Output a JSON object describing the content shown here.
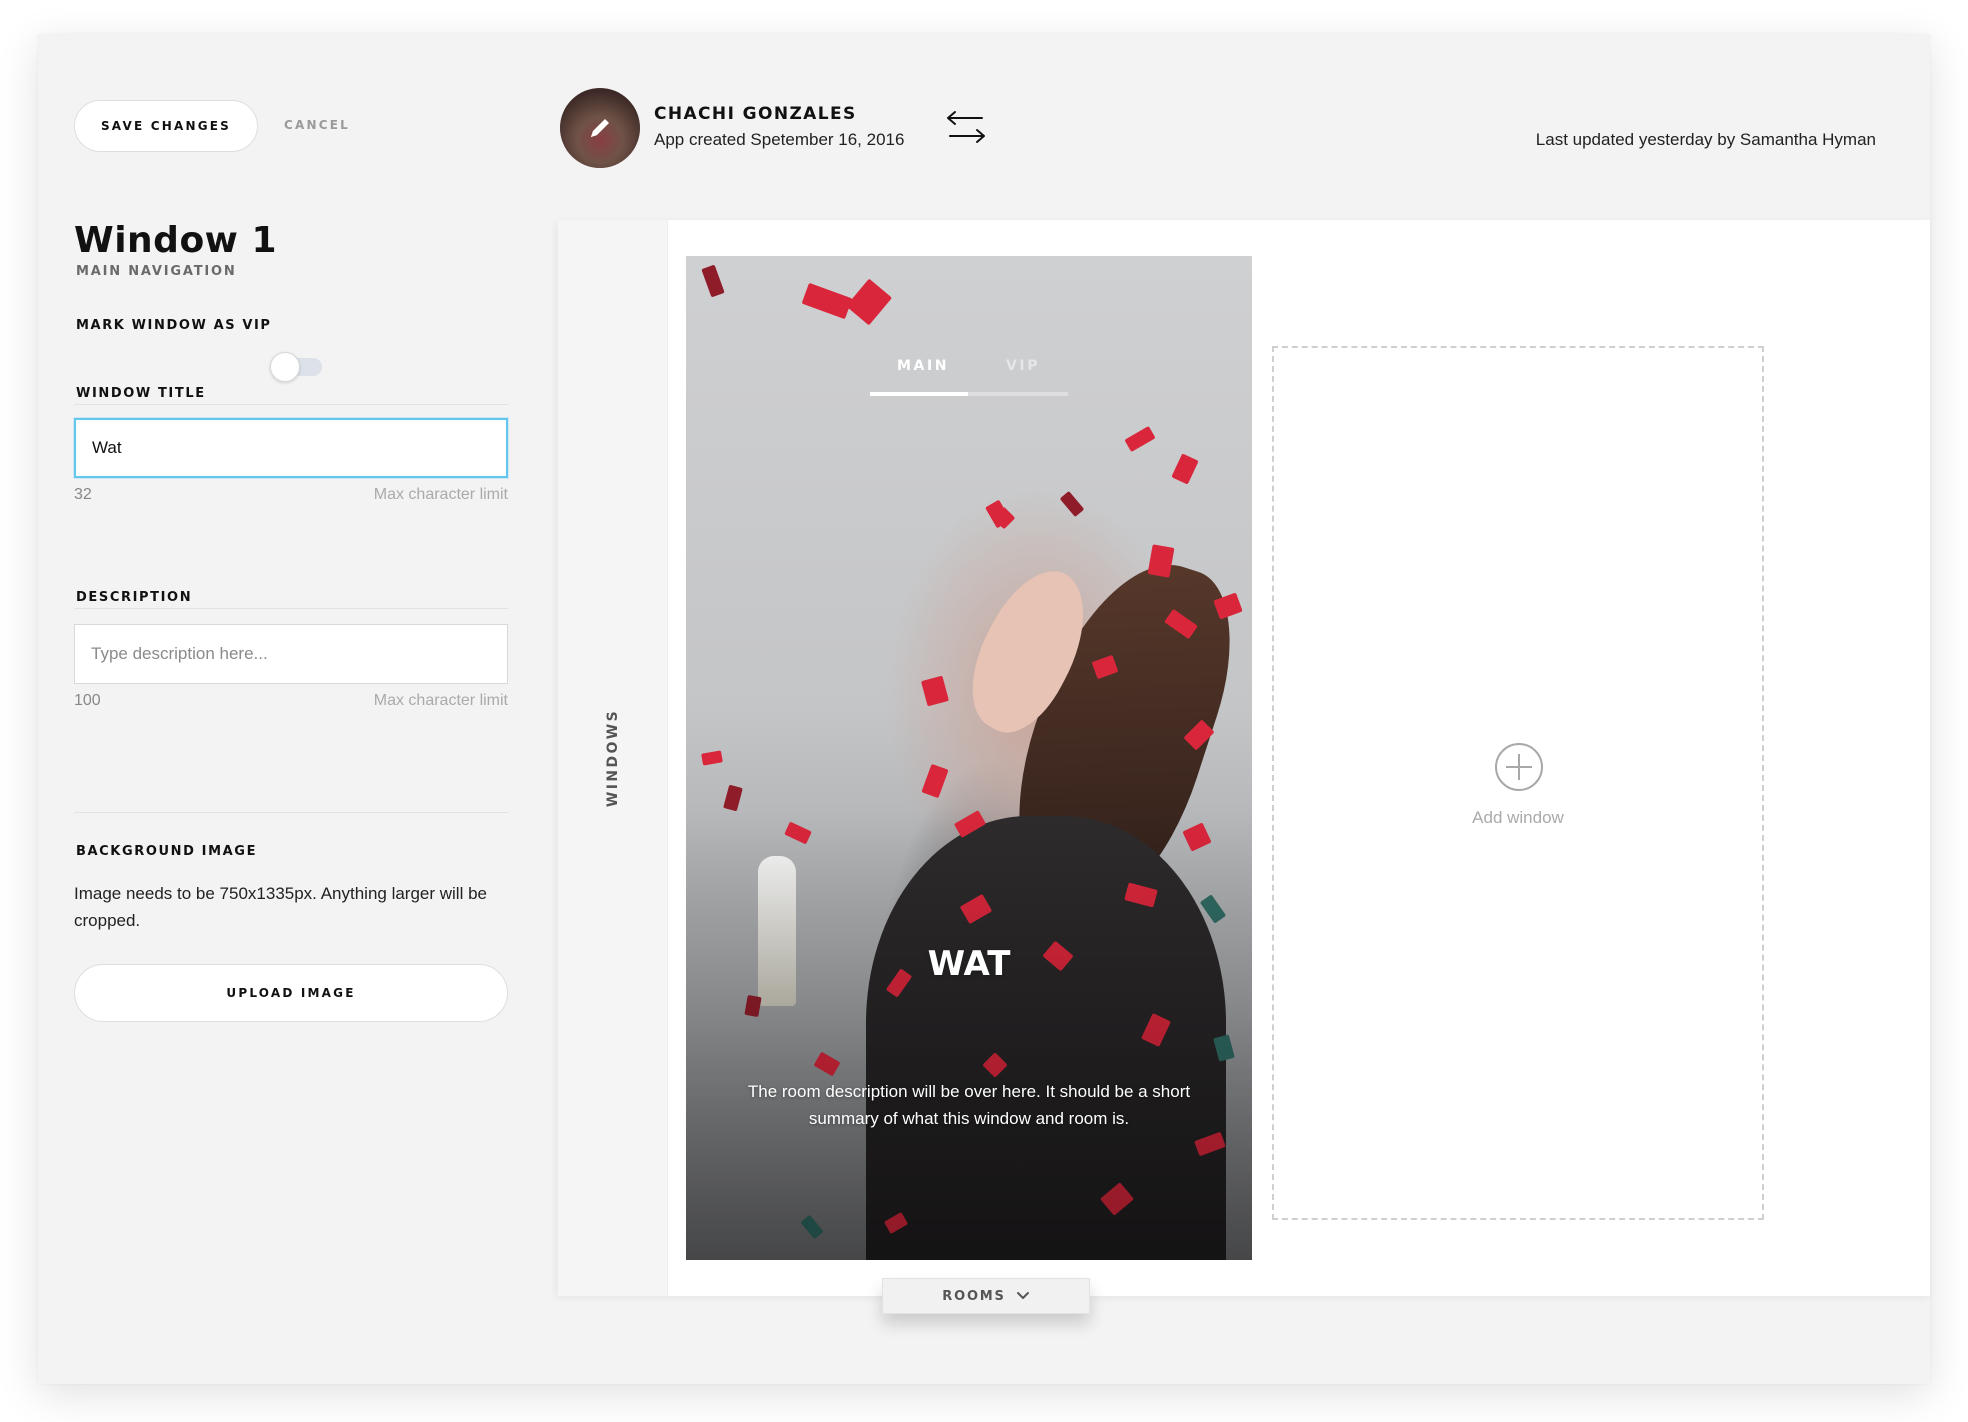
{
  "toolbar": {
    "save_label": "SAVE CHANGES",
    "cancel_label": "CANCEL"
  },
  "panel": {
    "title": "Window 1",
    "subtitle": "MAIN NAVIGATION",
    "vip": {
      "label": "MARK WINDOW AS VIP",
      "enabled": false
    },
    "window_title": {
      "label": "WINDOW TITLE",
      "value": "Wat",
      "char_limit": "32",
      "hint": "Max character limit"
    },
    "description": {
      "label": "DESCRIPTION",
      "value": "",
      "placeholder": "Type description here...",
      "char_limit": "100",
      "hint": "Max character limit"
    },
    "background_image": {
      "label": "BACKGROUND IMAGE",
      "help": "Image needs to be 750x1335px. Anything larger will be cropped.",
      "upload_label": "UPLOAD IMAGE"
    }
  },
  "header": {
    "owner_name": "CHACHI GONZALES",
    "created": "App created Spetember 16, 2016",
    "last_updated": "Last updated yesterday by Samantha Hyman"
  },
  "canvas": {
    "rail_label": "WINDOWS",
    "preview": {
      "tabs": [
        {
          "label": "MAIN",
          "active": true
        },
        {
          "label": "VIP",
          "active": false
        }
      ],
      "title": "WAT",
      "description": "The room description will be over here. It should be a short summary of what this window and room is."
    },
    "add_window_label": "Add window",
    "rooms_label": "ROOMS"
  },
  "icons": {
    "avatar_edit": "pencil-icon",
    "swap": "swap-arrows-icon",
    "add": "plus-circle-icon",
    "rooms_toggle": "chevron-down-icon"
  },
  "colors": {
    "focus_border": "#62c6ee",
    "panel_bg": "#f3f3f3",
    "text": "#111111",
    "muted": "#9a9a9a"
  }
}
